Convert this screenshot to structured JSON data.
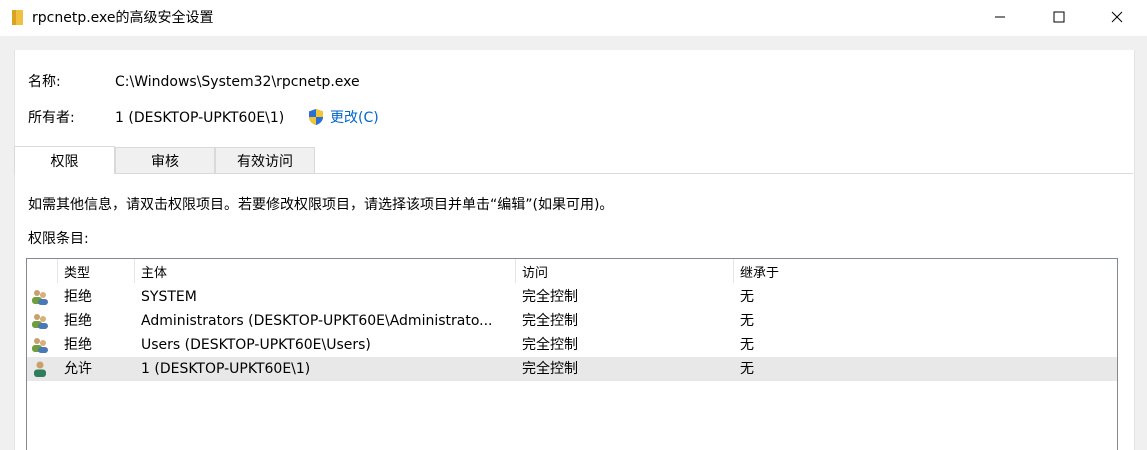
{
  "window": {
    "title": "rpcnetp.exe的高级安全设置"
  },
  "info": {
    "name_label": "名称:",
    "name_value": "C:\\Windows\\System32\\rpcnetp.exe",
    "owner_label": "所有者:",
    "owner_value": "1 (DESKTOP-UPKT60E\\1)",
    "change_link": "更改(C)"
  },
  "tabs": [
    {
      "label": "权限",
      "active": true
    },
    {
      "label": "审核",
      "active": false
    },
    {
      "label": "有效访问",
      "active": false
    }
  ],
  "permissions": {
    "instruction": "如需其他信息，请双击权限项目。若要修改权限项目，请选择该项目并单击“编辑”(如果可用)。",
    "entries_label": "权限条目:",
    "columns": [
      "类型",
      "主体",
      "访问",
      "继承于"
    ],
    "rows": [
      {
        "icon": "group-users-icon",
        "type": "拒绝",
        "principal": "SYSTEM",
        "access": "完全控制",
        "inherited": "无"
      },
      {
        "icon": "group-users-icon",
        "type": "拒绝",
        "principal": "Administrators (DESKTOP-UPKT60E\\Administrato...",
        "access": "完全控制",
        "inherited": "无"
      },
      {
        "icon": "group-users-icon",
        "type": "拒绝",
        "principal": "Users (DESKTOP-UPKT60E\\Users)",
        "access": "完全控制",
        "inherited": "无"
      },
      {
        "icon": "single-user-icon",
        "type": "允许",
        "principal": "1 (DESKTOP-UPKT60E\\1)",
        "access": "完全控制",
        "inherited": "无",
        "selected": true
      }
    ]
  },
  "colors": {
    "link": "#0066cc",
    "selected_row": "#e8e8e8",
    "folder_icon": "#f0c040"
  }
}
